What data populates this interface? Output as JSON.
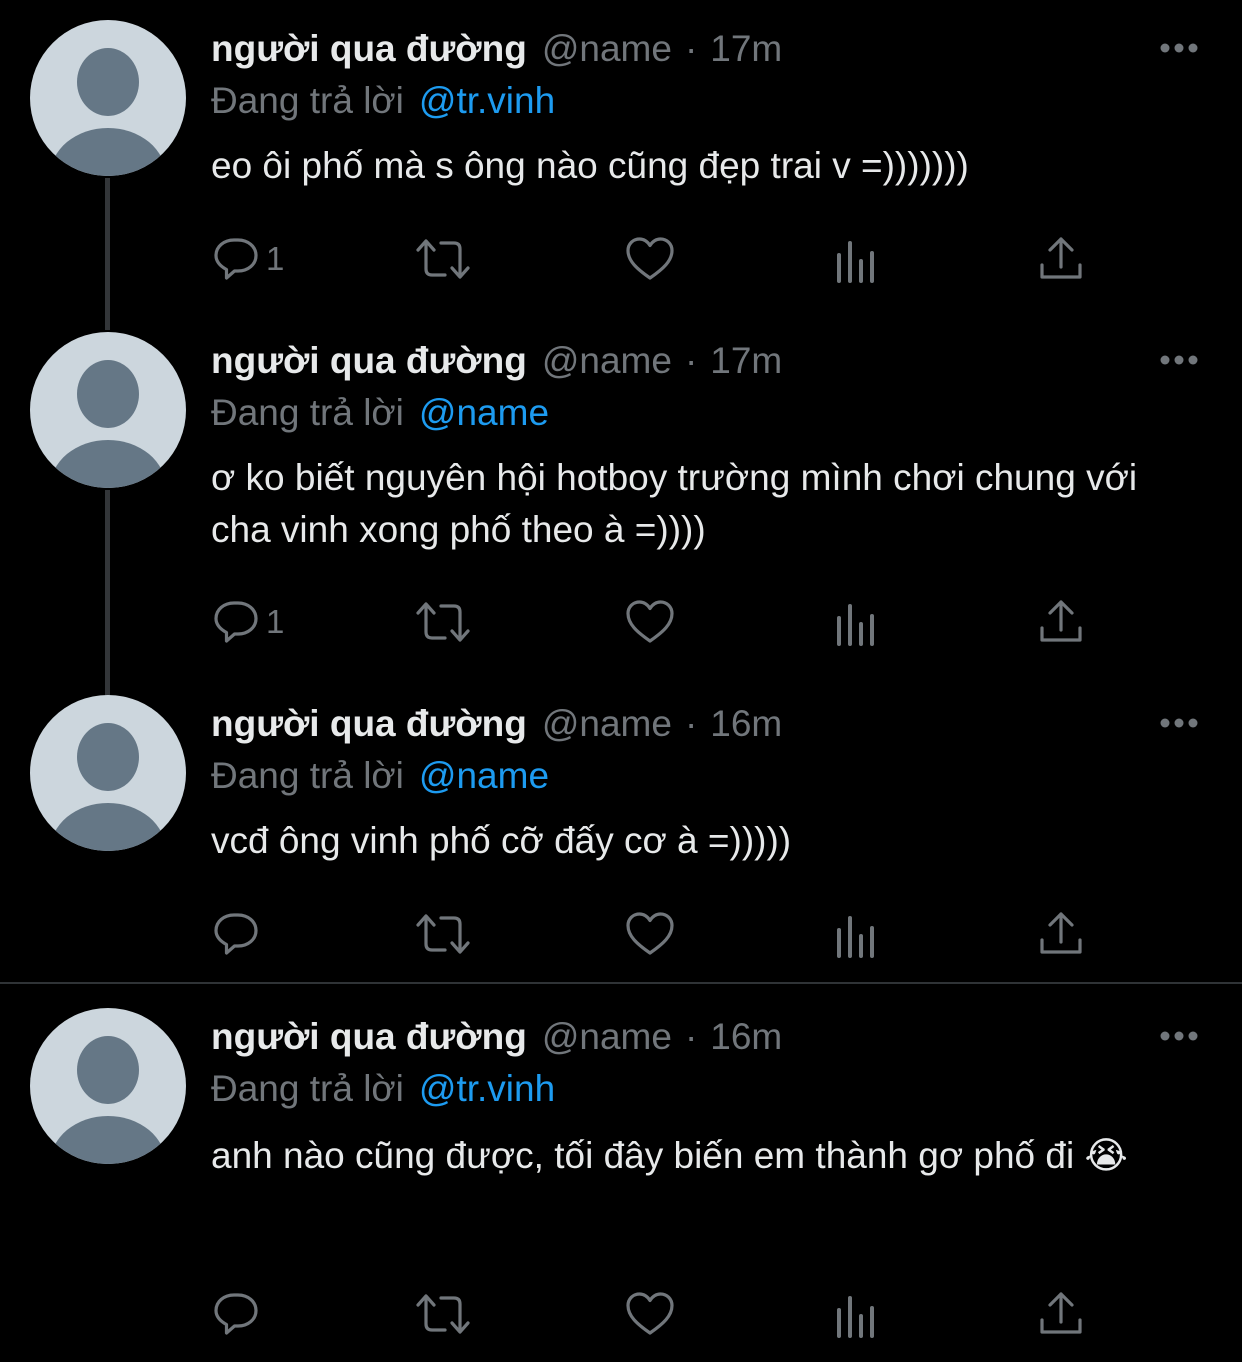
{
  "theme": {
    "background": "#000000",
    "text": "#e7e9ea",
    "muted": "#71767b",
    "link": "#1d9bf0",
    "avatar_bg": "#ccd6dd",
    "avatar_fg": "#657786"
  },
  "icons": {
    "reply": "reply-icon",
    "retweet": "retweet-icon",
    "like": "heart-icon",
    "views": "views-icon",
    "share": "share-icon",
    "more": "more-icon"
  },
  "tweets": [
    {
      "display_name": "người qua đường",
      "handle": "@name",
      "separator": "·",
      "time": "17m",
      "reply_prefix": "Đang trả lời",
      "reply_to": "@tr.vinh",
      "text": "eo ôi phố mà s ông nào cũng đẹp trai v =)))))))",
      "reply_count": "1"
    },
    {
      "display_name": "người qua đường",
      "handle": "@name",
      "separator": "·",
      "time": "17m",
      "reply_prefix": "Đang trả lời",
      "reply_to": "@name",
      "text": "ơ ko biết nguyên hội hotboy trường mình chơi chung với cha vinh xong phố theo à =))))",
      "reply_count": "1"
    },
    {
      "display_name": "người qua đường",
      "handle": "@name",
      "separator": "·",
      "time": "16m",
      "reply_prefix": "Đang trả lời",
      "reply_to": "@name",
      "text": "vcđ ông vinh phố cỡ đấy cơ à =)))))",
      "reply_count": ""
    },
    {
      "display_name": "người qua đường",
      "handle": "@name",
      "separator": "·",
      "time": "16m",
      "reply_prefix": "Đang trả lời",
      "reply_to": "@tr.vinh",
      "text": "anh nào cũng được, tối đây biến em thành gơ phố đi 😭",
      "reply_count": ""
    }
  ]
}
